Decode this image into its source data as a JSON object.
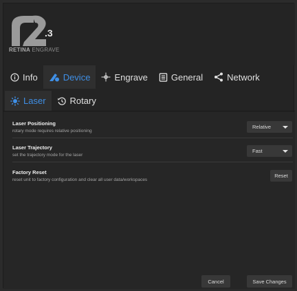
{
  "brand": {
    "version": ".3",
    "name_bold": "RETINA",
    "name_light": "ENGRAVE"
  },
  "main_tabs": [
    {
      "label": "Info",
      "icon": "info-icon"
    },
    {
      "label": "Device",
      "icon": "laser-device-icon",
      "active": true
    },
    {
      "label": "Engrave",
      "icon": "engrave-icon"
    },
    {
      "label": "General",
      "icon": "general-icon"
    },
    {
      "label": "Network",
      "icon": "share-icon"
    }
  ],
  "sub_tabs": [
    {
      "label": "Laser",
      "icon": "sun-icon",
      "active": true
    },
    {
      "label": "Rotary",
      "icon": "rotate-icon"
    }
  ],
  "settings": {
    "laser_positioning": {
      "title": "Laser Positioning",
      "description": "rotary mode requires relative positioning",
      "value": "Relative"
    },
    "laser_trajectory": {
      "title": "Laser Trajectory",
      "description": "set the trajectory mode for the laser",
      "value": "Fast"
    },
    "factory_reset": {
      "title": "Factory Reset",
      "description": "reset unit to factory configuration and clear all user data/workspaces",
      "button": "Reset"
    }
  },
  "footer": {
    "cancel": "Cancel",
    "save": "Save Changes"
  },
  "colors": {
    "accent": "#3f8fe6",
    "background": "#242424",
    "control": "#383838"
  }
}
